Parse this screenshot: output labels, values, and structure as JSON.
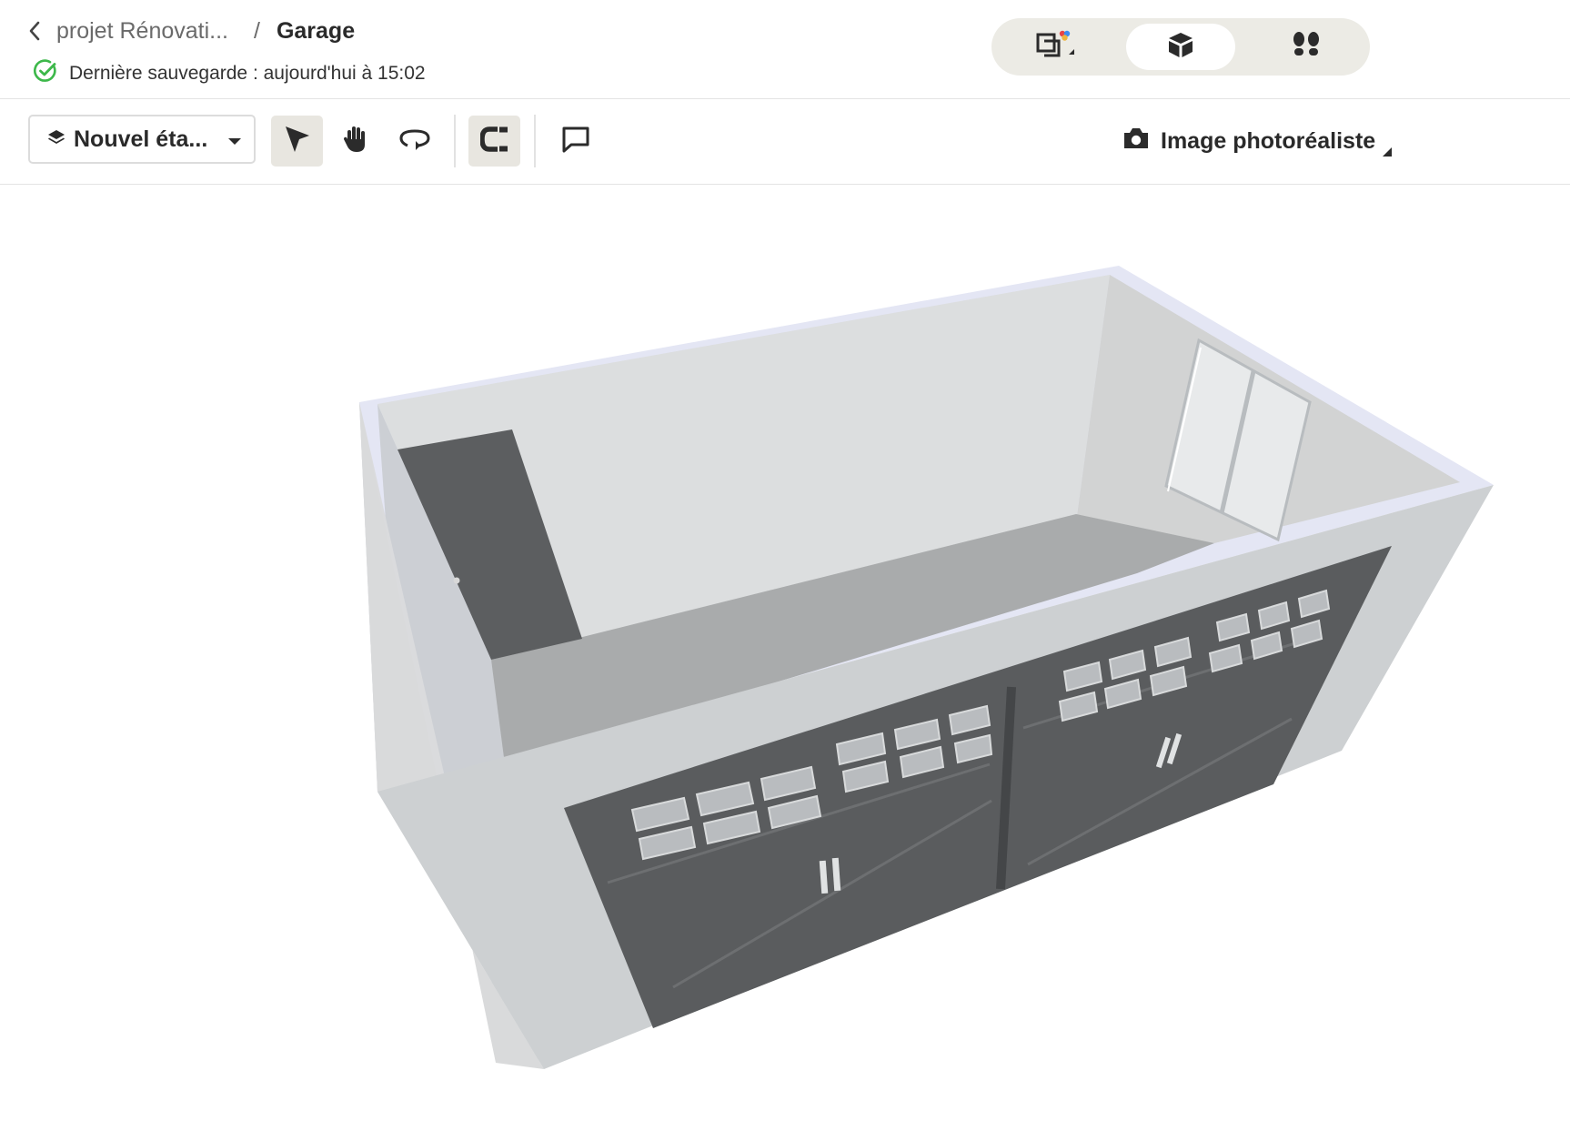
{
  "breadcrumb": {
    "project": "projet Rénovati...",
    "separator": "/",
    "current": "Garage"
  },
  "save_status": {
    "text": "Dernière sauvegarde : aujourd'hui à 15:02",
    "icon": "check-circle-icon",
    "color": "#3db84a"
  },
  "view_modes": [
    {
      "name": "2d-plan",
      "icon": "floor-plan-icon",
      "active": false
    },
    {
      "name": "3d-view",
      "icon": "cube-icon",
      "active": true
    },
    {
      "name": "walkthrough",
      "icon": "footsteps-icon",
      "active": false
    }
  ],
  "toolbar": {
    "state_label": "Nouvel éta...",
    "tools": [
      {
        "name": "select-tool",
        "icon": "cursor-icon",
        "active": true
      },
      {
        "name": "pan-tool",
        "icon": "hand-icon",
        "active": false
      },
      {
        "name": "rotate-tool",
        "icon": "rotate-icon",
        "active": false
      },
      {
        "name": "magnet-tool",
        "icon": "magnet-icon",
        "active": true
      },
      {
        "name": "comment-tool",
        "icon": "comment-icon",
        "active": false
      }
    ],
    "photo_label": "Image photoréaliste",
    "photo_icon": "camera-icon"
  },
  "scene": {
    "room": "Garage",
    "wall_color": "#e6e8ea",
    "floor_color": "#a9abac",
    "door_color": "#5a5c5e"
  },
  "colors": {
    "accent_active_bg": "#e8e6e0",
    "toggle_bg": "#ecebe5"
  }
}
